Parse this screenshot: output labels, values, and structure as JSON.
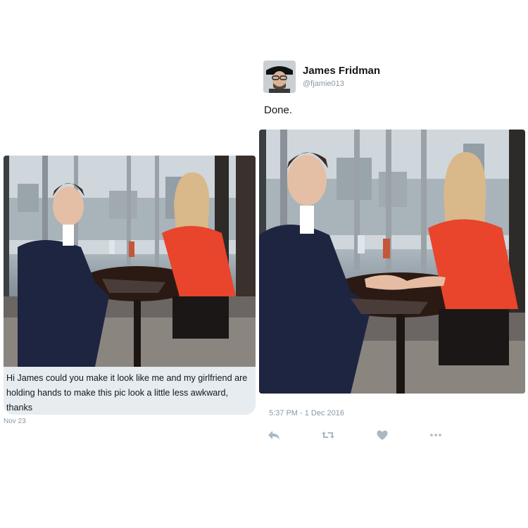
{
  "left_message": {
    "text": "Hi James could you make it look like me and my girlfriend are holding hands to make this pic look a little less awkward, thanks",
    "date": "Nov 23"
  },
  "tweet": {
    "author_name": "James Fridman",
    "author_handle": "@fjamie013",
    "text": "Done.",
    "timestamp": "5:37 PM - 1 Dec 2016"
  },
  "actions": {
    "reply_icon": "reply-arrow",
    "retweet_icon": "retweet-arrows",
    "like_icon": "heart",
    "more_icon": "ellipsis"
  },
  "colors": {
    "bubble": "#e6ecf0",
    "muted_text": "#8899a6",
    "action_icons": "#aab8c2",
    "blouse": "#e8452c",
    "suit": "#1e2540"
  }
}
